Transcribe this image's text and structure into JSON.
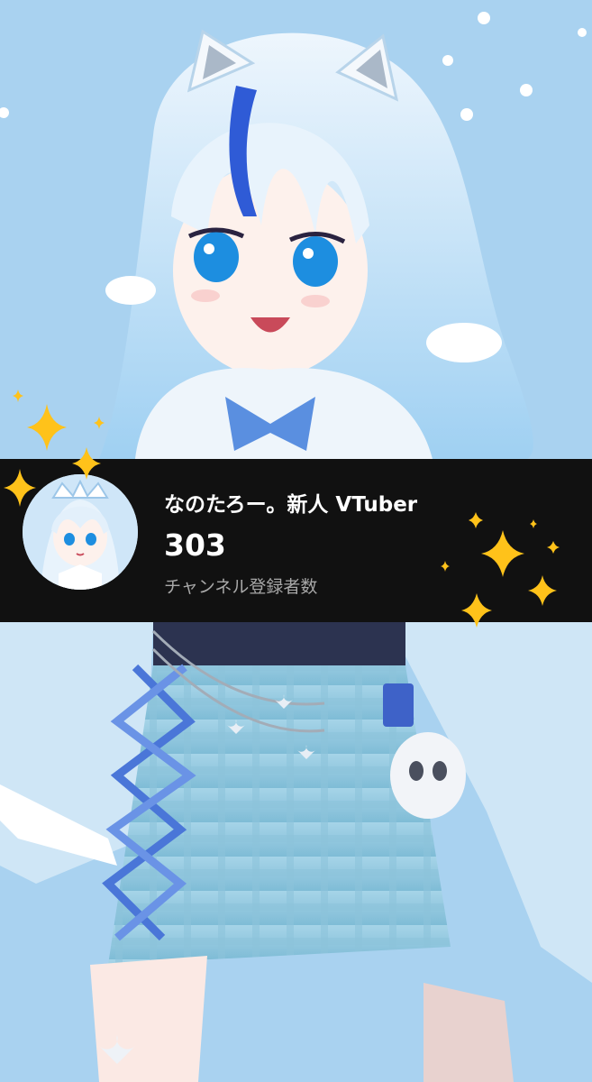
{
  "channel": {
    "name": "なのたろー。新人 VTuber",
    "subscriber_count": "303",
    "subscriber_label": "チャンネル登録者数"
  },
  "colors": {
    "background": "#a9d2f0",
    "banner": "#111111",
    "sparkle": "#ffc21a"
  },
  "icons": [
    "sparkle-icon",
    "avatar-image"
  ]
}
